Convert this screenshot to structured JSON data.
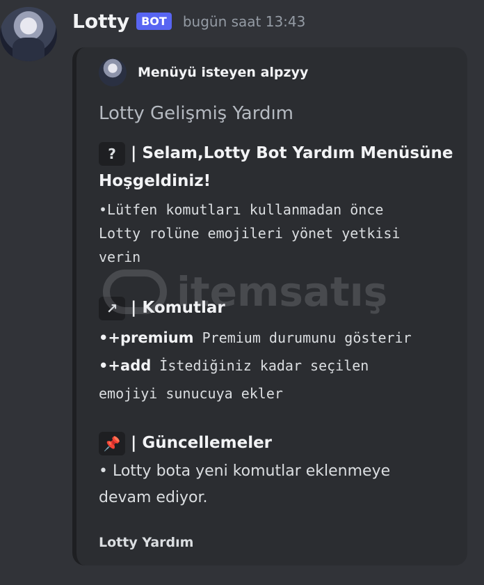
{
  "message": {
    "username": "Lotty",
    "badge": "BOT",
    "timestamp": "bugün saat 13:43"
  },
  "embed": {
    "author": "Menüyü isteyen alpzyy",
    "title": "Lotty Gelişmiş Yardım",
    "section1": {
      "emoji": "?",
      "heading_line1": "| Selam,Lotty Bot Yardım Menüsüne",
      "heading_line2": "Hoşgeldiniz!",
      "body_line1": "•Lütfen komutları kullanmadan önce",
      "body_line2": "Lotty rolüne emojileri yönet yetkisi",
      "body_line3": "verin"
    },
    "section2": {
      "emoji": "↗",
      "heading": "| Komutlar",
      "cmd1_name": "•+premium",
      "cmd1_desc": " Premium durumunu gösterir",
      "cmd2_name": "•+add",
      "cmd2_desc": " İstediğiniz kadar seçilen",
      "cmd2_desc_line2": "emojiyi sunucuya ekler"
    },
    "section3": {
      "emoji": "📌",
      "heading": "| Güncellemeler",
      "body_line1": "• Lotty bota yeni komutlar eklenmeye",
      "body_line2": "devam ediyor."
    },
    "footer": "Lotty Yardım"
  },
  "watermark": {
    "text": "itemsatış"
  },
  "colors": {
    "background": "#313338",
    "embed_bg": "#2b2d31",
    "badge": "#5865f2"
  }
}
